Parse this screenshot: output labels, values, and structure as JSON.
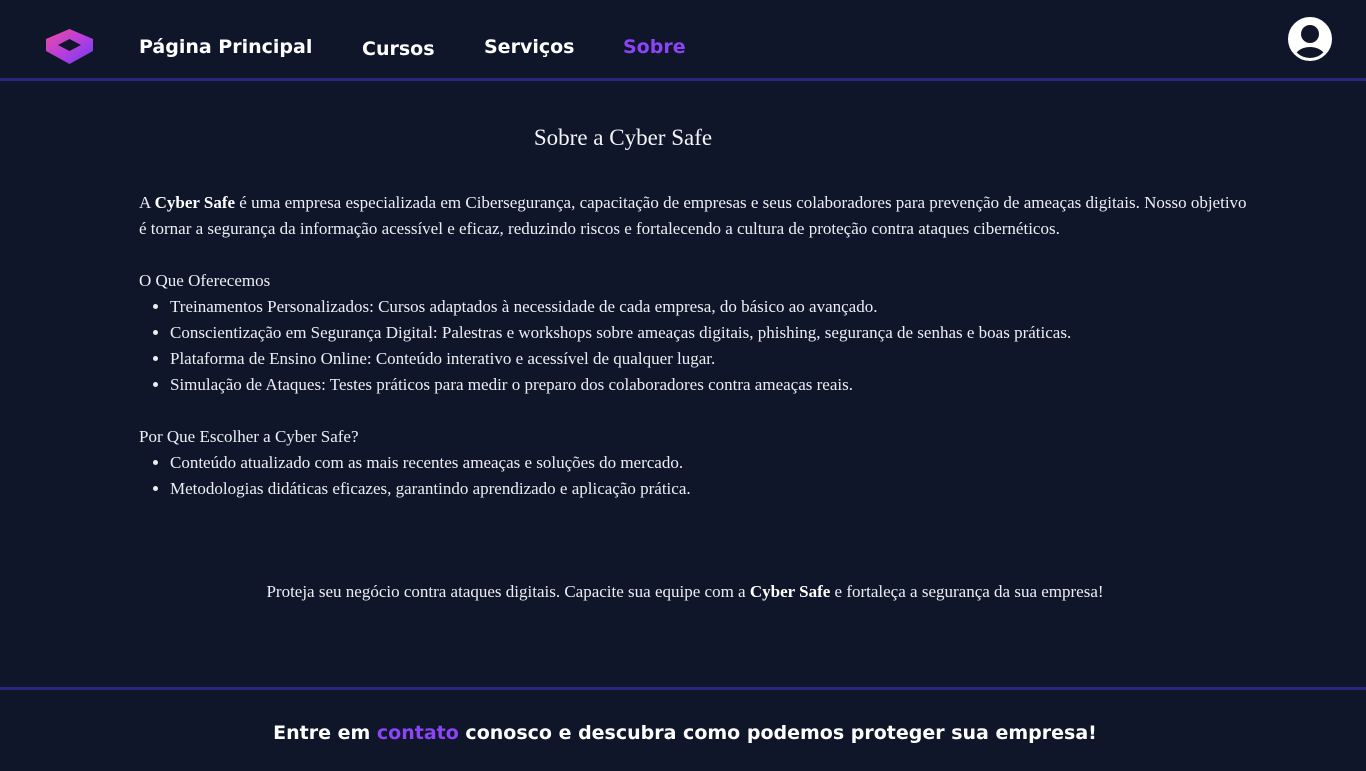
{
  "header": {
    "logo_icon": "cube-logo-icon",
    "nav": {
      "home": "Página Principal",
      "cursos": "Cursos",
      "servicos": "Serviços",
      "sobre": "Sobre"
    },
    "active_nav": "sobre",
    "user_icon": "user-avatar-icon"
  },
  "main": {
    "title": "Sobre a Cyber Safe",
    "intro": {
      "prefix": "A ",
      "brand": "Cyber Safe",
      "text": " é uma empresa especializada em Cibersegurança, capacitação de empresas e seus colaboradores para prevenção de ameaças digitais. Nosso objetivo é tornar a segurança da informação acessível e eficaz, reduzindo riscos e fortalecendo a cultura de proteção contra ataques cibernéticos."
    },
    "offer_title": "O Que Oferecemos",
    "offer_items": [
      "Treinamentos Personalizados: Cursos adaptados à necessidade de cada empresa, do básico ao avançado.",
      "Conscientização em Segurança Digital: Palestras e workshops sobre ameaças digitais, phishing, segurança de senhas e boas práticas.",
      "Plataforma de Ensino Online: Conteúdo interativo e acessível de qualquer lugar.",
      "Simulação de Ataques: Testes práticos para medir o preparo dos colaboradores contra ameaças reais."
    ],
    "why_title": "Por Que Escolher a Cyber Safe?",
    "why_items": [
      "Conteúdo atualizado com as mais recentes ameaças e soluções do mercado.",
      "Metodologias didáticas eficazes, garantindo aprendizado e aplicação prática."
    ],
    "cta": {
      "before": "Proteja seu negócio contra ataques digitais. Capacite sua equipe com a ",
      "brand": "Cyber Safe",
      "after": " e fortaleça a segurança da sua empresa!"
    }
  },
  "footer": {
    "before": "Entre em ",
    "link": "contato",
    "after": " conosco e descubra como podemos proteger sua empresa!"
  },
  "colors": {
    "background": "#101629",
    "accent": "#8b45f6",
    "divider": "#27287a",
    "logo_gradient_start": "#e23a9a",
    "logo_gradient_end": "#7a3cf0"
  }
}
